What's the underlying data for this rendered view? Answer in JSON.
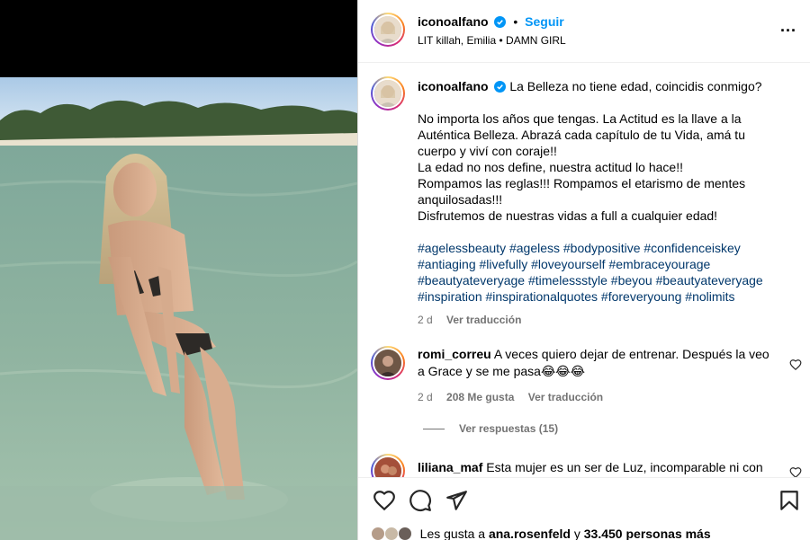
{
  "post": {
    "username": "iconoalfano",
    "follow_label": "Seguir",
    "audio": "LIT killah, Emilia",
    "audio_sep": "•",
    "audio_track": "DAMN GIRL",
    "more_label": "..."
  },
  "caption": {
    "username": "iconoalfano",
    "headline": "La Belleza no tiene edad, coincidis conmigo?",
    "lines": [
      "No importa los años que tengas. La Actitud es la llave a la Auténtica Belleza. Abrazá cada capítulo de tu Vida, amá tu cuerpo y viví con coraje!!",
      "La edad no nos define, nuestra actitud lo hace!!",
      "Rompamos las reglas!!! Rompamos el etarismo de mentes anquilosadas!!!",
      "Disfrutemos de nuestras vidas a full a cualquier edad!"
    ],
    "hashtags": "#agelessbeauty #ageless #bodypositive #confidenceiskey #antiaging #livefully #loveyourself #embraceyourage #beautyateveryage #timelessstyle #beyou #beautyateveryage #inspiration #inspirationalquotes #foreveryoung #nolimits",
    "time": "2 d",
    "translate": "Ver traducción"
  },
  "comments": [
    {
      "username": "romi_correu",
      "text": "A veces quiero dejar de entrenar. Después la veo a Grace y se me pasa😂😂😂",
      "time": "2 d",
      "likes": "208 Me gusta",
      "translate": "Ver traducción",
      "replies": "Ver respuestas (15)"
    },
    {
      "username": "liliana_maf",
      "text": "Esta mujer es un ser de Luz, incomparable ni con"
    }
  ],
  "likes_bar": {
    "prefix": "Les gusta a",
    "user": "ana.rosenfeld",
    "mid": "y",
    "count": "33.450 personas más"
  },
  "colors": {
    "accent": "#0095f6",
    "hashtag": "#00376b",
    "muted": "#737373"
  }
}
